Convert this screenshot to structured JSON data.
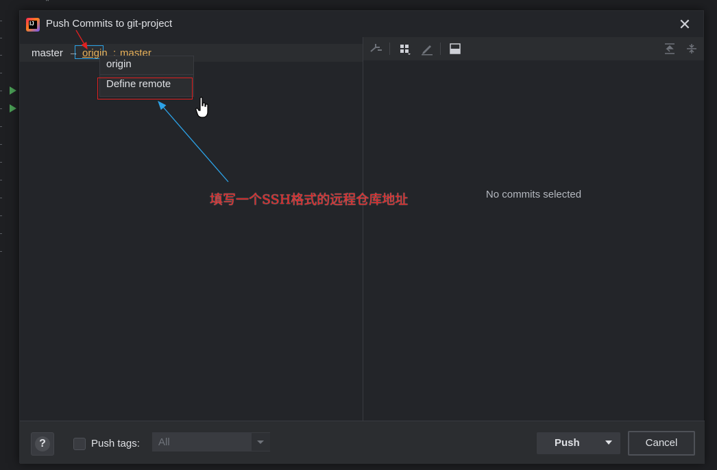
{
  "dialog": {
    "title": "Push Commits to git-project",
    "close_glyph": "✕"
  },
  "branches": {
    "local": "master",
    "arrow": "→",
    "remote": "origin",
    "separator": ":",
    "remote_branch": "master"
  },
  "remote_popup": {
    "items": [
      {
        "label": "origin"
      },
      {
        "label": "Define remote"
      }
    ]
  },
  "annotation": {
    "text": "填写一个SSH格式的远程仓库地址",
    "color": "#e02020",
    "arrow_color": "#2ca3e8"
  },
  "commit_details": {
    "empty_text": "No commits selected",
    "toolbar_icons": [
      "cherry-pick-icon",
      "group-by-icon",
      "edit-icon",
      "preview-icon",
      "expand-all-icon",
      "collapse-all-icon"
    ]
  },
  "footer": {
    "help_label": "?",
    "push_tags_label": "Push tags:",
    "push_tags_checked": false,
    "tags_select_value": "All",
    "push_label": "Push",
    "cancel_label": "Cancel"
  },
  "colors": {
    "accent_link": "#e8b15a",
    "focus_border": "#2ca3e8",
    "run_icon": "#499c54"
  }
}
